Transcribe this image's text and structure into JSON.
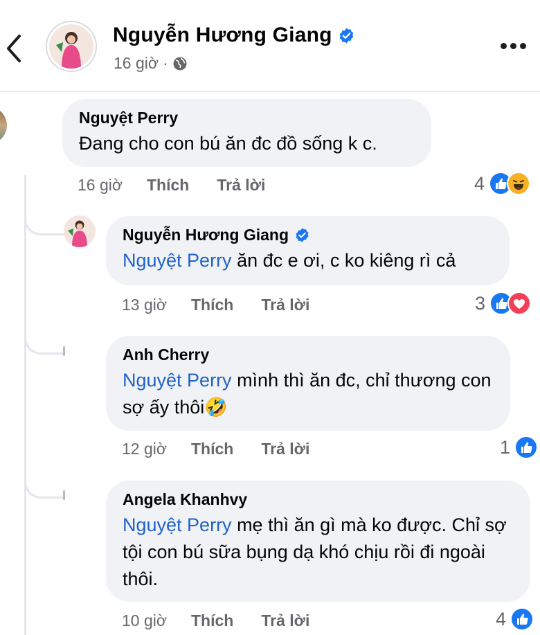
{
  "header": {
    "name": "Nguyễn Hương Giang",
    "time": "16 giờ",
    "dot": "·",
    "back_icon": "chevron-left-icon",
    "more_icon": "ellipsis-icon",
    "audience_icon": "globe-icon"
  },
  "comments": [
    {
      "author": "Nguyệt Perry",
      "text": "Đang cho con bú ăn đc đồ sống k c.",
      "time": "16 giờ",
      "like_label": "Thích",
      "reply_label": "Trả lời",
      "reaction_count": "4",
      "reactions": [
        "like",
        "haha"
      ]
    }
  ],
  "replies": [
    {
      "author": "Nguyễn Hương Giang",
      "verified": true,
      "mention": "Nguyệt Perry",
      "text": " ăn đc e ơi, c ko kiêng rì cả",
      "time": "13 giờ",
      "like_label": "Thích",
      "reply_label": "Trả lời",
      "reaction_count": "3",
      "reactions": [
        "like",
        "love"
      ]
    },
    {
      "author": "Anh Cherry",
      "mention": "Nguyệt Perry",
      "text": " mình thì ăn đc, chỉ thương con sợ ấy thôi🤣",
      "time": "12 giờ",
      "like_label": "Thích",
      "reply_label": "Trả lời",
      "reaction_count": "1",
      "reactions": [
        "like"
      ]
    },
    {
      "author": "Angela Khanhvy",
      "mention": "Nguyệt Perry",
      "text": " mẹ thì ăn gì mà ko được. Chỉ sợ tội con bú sữa bụng dạ khó chịu rồi đi ngoài thôi.",
      "time": "10 giờ",
      "like_label": "Thích",
      "reply_label": "Trả lời",
      "reaction_count": "4",
      "reactions": [
        "like"
      ]
    }
  ],
  "colors": {
    "link": "#1e62c8",
    "bubble": "#f0f2f5",
    "muted": "#65676b",
    "facebook_blue": "#1877f2",
    "love_red": "#f33e58",
    "haha_yellow": "#f7b125"
  }
}
